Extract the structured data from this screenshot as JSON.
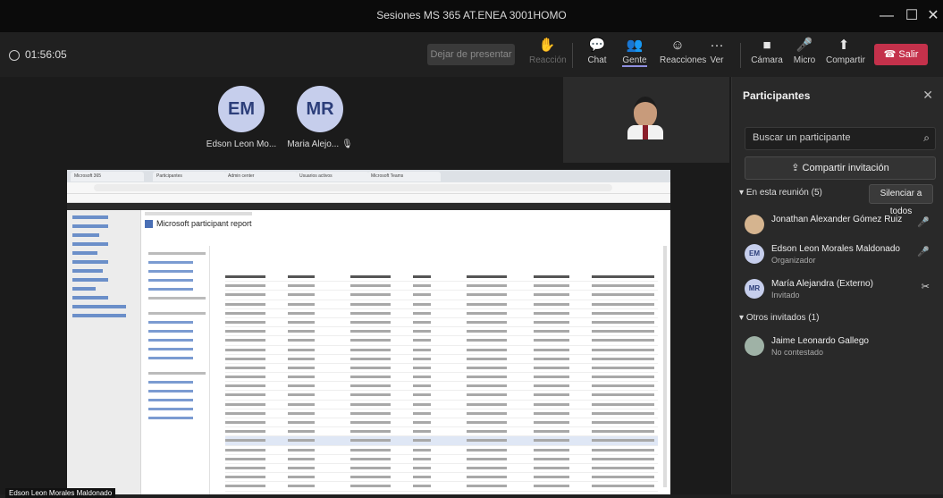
{
  "window": {
    "title": "Sesiones MS 365 AT.ENEA 3001HOMO"
  },
  "toolbar": {
    "timer": "01:56:05",
    "stop_share_label": "Dejar de presentar",
    "buttons": [
      {
        "label": "Reacción",
        "icon": "hand-icon"
      },
      {
        "label": "Chat",
        "icon": "chat-icon"
      },
      {
        "label": "Gente",
        "icon": "people-icon"
      },
      {
        "label": "Reacciones",
        "icon": "emoji-icon"
      },
      {
        "label": "Ver",
        "icon": "more-icon"
      },
      {
        "label": "Cámara",
        "icon": "camera-icon"
      },
      {
        "label": "Micro",
        "icon": "mic-icon"
      },
      {
        "label": "Compartir",
        "icon": "share-icon"
      }
    ],
    "leave_label": "Salir"
  },
  "stage": {
    "avatars": [
      {
        "initials": "EM",
        "name": "Edson Leon Mo..."
      },
      {
        "initials": "MR",
        "name": "Maria Alejo..."
      }
    ],
    "presenter_name": "Edson Leon Morales Maldonado"
  },
  "shared_screen": {
    "tabs": [
      "Microsoft 365",
      "Participantes",
      "Admin center",
      "Usuarios activos",
      "Microsoft Teams"
    ],
    "page_title": "Microsoft participant report"
  },
  "participants": {
    "title": "Participantes",
    "search_placeholder": "Buscar un participante",
    "share_invite_label": "Compartir invitación",
    "in_meeting_label": "En esta reunión (5)",
    "mute_all_label": "Silenciar a todos",
    "in_meeting": [
      {
        "name": "Jonathan Alexander Gómez Ruiz",
        "sub": "",
        "initials": "",
        "mic": "mic-icon"
      },
      {
        "name": "Edson Leon Morales Maldonado",
        "sub": "Organizador",
        "initials": "EM",
        "mic": "mic-icon"
      },
      {
        "name": "María Alejandra (Externo)",
        "sub": "Invitado",
        "initials": "MR",
        "mic": "mic-off-icon"
      }
    ],
    "others_label": "Otros invitados (1)",
    "others": [
      {
        "name": "Jaime Leonardo Gallego",
        "sub": "No contestado",
        "initials": "",
        "mic": ""
      }
    ]
  }
}
